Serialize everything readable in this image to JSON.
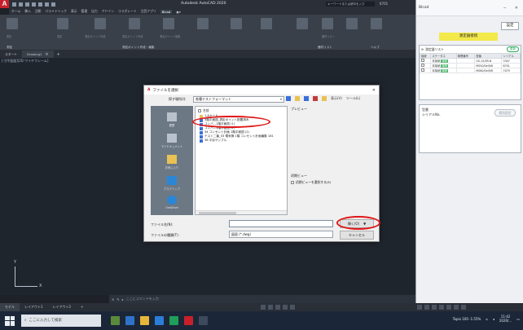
{
  "app": {
    "title": "Autodesk AutoCAD 2020",
    "search_placeholder": "キーワードまたは語句を入力",
    "user": "6701",
    "menu": [
      "ホーム",
      "挿入",
      "注釈",
      "パラメトリック",
      "表示",
      "管理",
      "出力",
      "アドイン",
      "コラボレート",
      "注目アプリ",
      "BIcad",
      "▣▾"
    ],
    "menu_active_index": 10,
    "ribbon_groups": [
      "測定",
      "測定ポイント作成・編集",
      "器材リスト",
      "ヘルプ"
    ],
    "ribbon_labels": [
      "測定",
      "測定",
      "測定ポイント作成",
      "測定ポイント作成",
      "測定ポイント編集",
      "",
      "",
      "器材リスト",
      ""
    ],
    "doc_tabs": [
      "スタート",
      "Drawing1"
    ],
    "view_label": "[-][平面図][2D ワイヤフレーム]",
    "ucs": {
      "x": "X",
      "y": "Y"
    },
    "command_placeholder": "ここにコマンドを入力",
    "layout_tabs": [
      "モデル",
      "レイアウト1",
      "レイアウト2",
      "+"
    ],
    "status_model": "モデル"
  },
  "taskbar": {
    "search_placeholder": "ここに入力して検索",
    "weather": "Topix 100  -1.55%",
    "time": "11:42",
    "date": "2020/..."
  },
  "plugin": {
    "window_title": "BIcad",
    "settings_btn": "設定",
    "measure_btn": "測定器接続",
    "list_title": "測定器リスト",
    "list_update_btn": "更新",
    "columns": [
      "接続",
      "ステータス",
      "管理番号",
      "型番",
      "シリアル"
    ],
    "rows": [
      {
        "status": "未接続",
        "badge": "接続",
        "model": "GS-15/SR-N",
        "serial": "3307"
      },
      {
        "status": "未接続",
        "badge": "接続",
        "model": "MS50/Self/W",
        "serial": "6701"
      },
      {
        "status": "未接続",
        "badge": "接続",
        "model": "MS60/Self/W",
        "serial": "7079"
      }
    ],
    "detail_model_label": "型番",
    "detail_serial_label": "シリアルNo.",
    "detail_btn": "個別設定"
  },
  "dialog": {
    "title": "ファイルを選択",
    "look_in_label": "探す場所(I):",
    "look_in_value": "各種テストフォーマット",
    "tools_views": "表示(V)",
    "tools_tools": "ツール(L)",
    "places": [
      "履歴",
      "マイドキュメント",
      "お気に入り",
      "デスクトップ",
      "OneDrive"
    ],
    "files_header": "名前",
    "files": [
      {
        "name": "1.Aヤード",
        "folder": true
      },
      {
        "name": "3階平面図_測定ポイント配置済み",
        "folder": false
      },
      {
        "name": "コンバ...1階平面図 (1)",
        "folder": false
      },
      {
        "name": "コンバ...3階平面図 (2)",
        "folder": false
      },
      {
        "name": "34 コンセント計画 1階平面図 (2)",
        "folder": false
      },
      {
        "name": "テスト二番_53 電気様 1階 コンセント計画編集 181",
        "folder": false
      },
      {
        "name": "36 平台サンプル",
        "folder": false
      }
    ],
    "preview_label": "プレビュー",
    "initial_view_label": "初期ビュー",
    "initial_view_checkbox": "初期ビューを選択する(E)",
    "filename_label": "ファイル名(N):",
    "filename_value": "",
    "filetype_label": "ファイルの種類(T):",
    "filetype_value": "図面 (*.dwg)",
    "open_btn": "開く(O)",
    "open_btn_arrow": "▼",
    "cancel_btn": "キャンセル"
  },
  "colors": {
    "autocad_bg": "#1f252d",
    "ribbon": "#3a4049",
    "highlight_red": "#e01515",
    "measure_yellow": "#f3e94a",
    "status_green": "#4ab46a"
  }
}
